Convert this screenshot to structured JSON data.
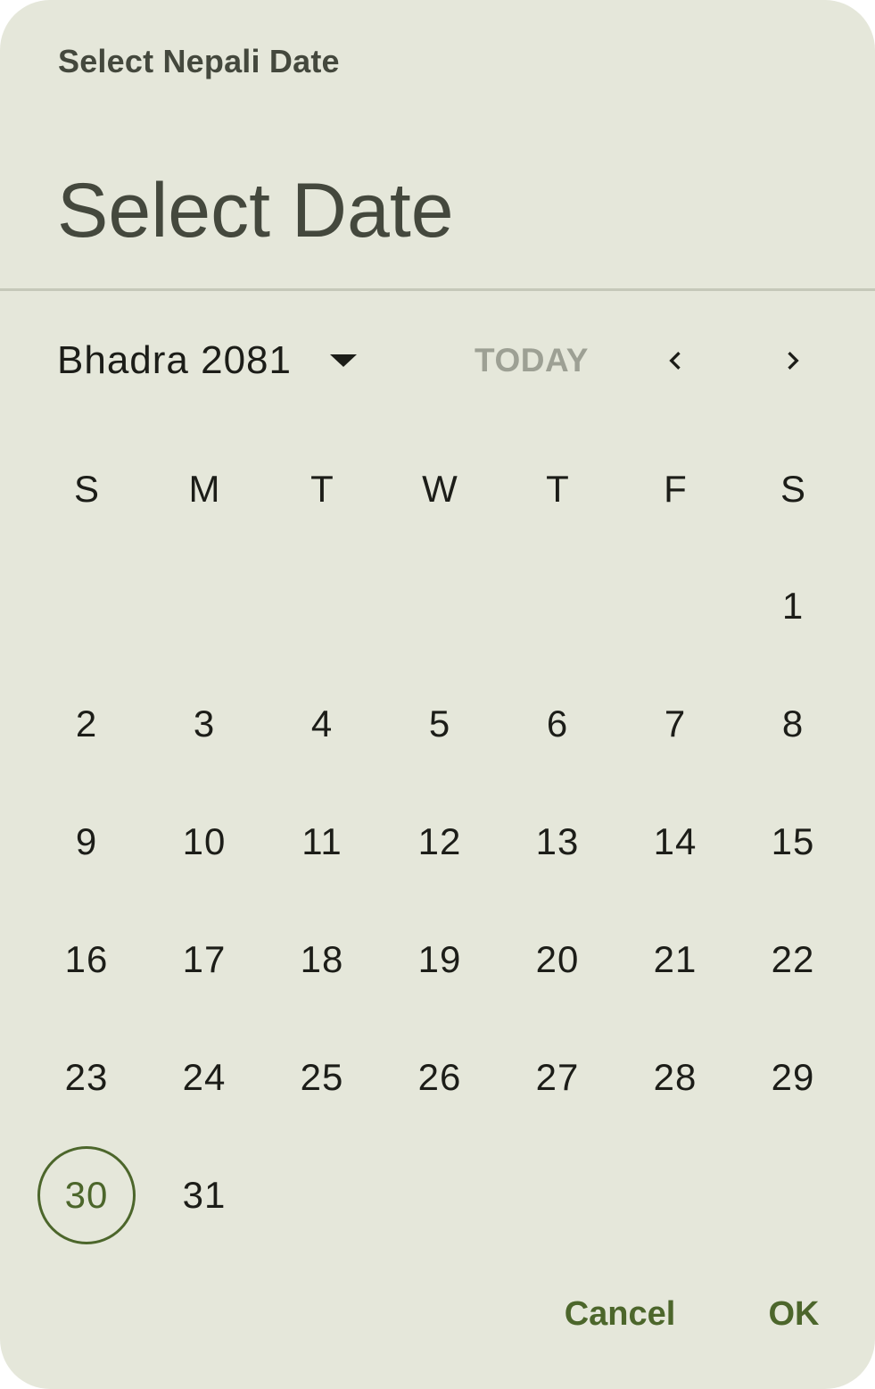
{
  "dialog": {
    "headline": "Select Nepali Date",
    "title": "Select Date"
  },
  "header": {
    "month_label": "Bhadra 2081",
    "today_label": "TODAY",
    "prev_icon": "chevron-left-icon",
    "next_icon": "chevron-right-icon",
    "dropdown_icon": "arrow-drop-down-icon"
  },
  "calendar": {
    "weekdays": [
      "S",
      "M",
      "T",
      "W",
      "T",
      "F",
      "S"
    ],
    "first_weekday_index": 6,
    "days": [
      "1",
      "2",
      "3",
      "4",
      "5",
      "6",
      "7",
      "8",
      "9",
      "10",
      "11",
      "12",
      "13",
      "14",
      "15",
      "16",
      "17",
      "18",
      "19",
      "20",
      "21",
      "22",
      "23",
      "24",
      "25",
      "26",
      "27",
      "28",
      "29",
      "30",
      "31"
    ],
    "selected_day": "30"
  },
  "actions": {
    "cancel_label": "Cancel",
    "ok_label": "OK"
  },
  "colors": {
    "surface": "#e5e7da",
    "primary": "#4c662b",
    "on_surface": "#1c1d18",
    "on_surface_variant": "#44483d",
    "disabled": "#9da094",
    "divider": "#c5c8b9"
  }
}
